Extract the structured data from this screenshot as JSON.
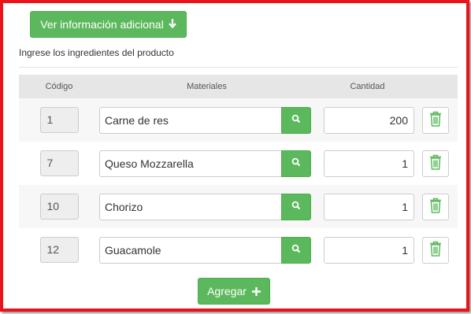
{
  "info_button": {
    "label": "Ver información adicional",
    "icon": "arrow-down-icon"
  },
  "subtitle": "Ingrese los ingredientes del producto",
  "table": {
    "headers": {
      "code": "Código",
      "materials": "Materiales",
      "quantity": "Cantidad"
    },
    "rows": [
      {
        "code": "1",
        "material": "Carne de res",
        "quantity": "200"
      },
      {
        "code": "7",
        "material": "Queso Mozzarella",
        "quantity": "1"
      },
      {
        "code": "10",
        "material": "Chorizo",
        "quantity": "1"
      },
      {
        "code": "12",
        "material": "Guacamole",
        "quantity": "1"
      }
    ]
  },
  "add_button": {
    "label": "Agregar",
    "icon": "plus-icon"
  },
  "colors": {
    "accent": "#5cb85c",
    "frame": "#e8141a",
    "trash": "#5cb85c"
  }
}
